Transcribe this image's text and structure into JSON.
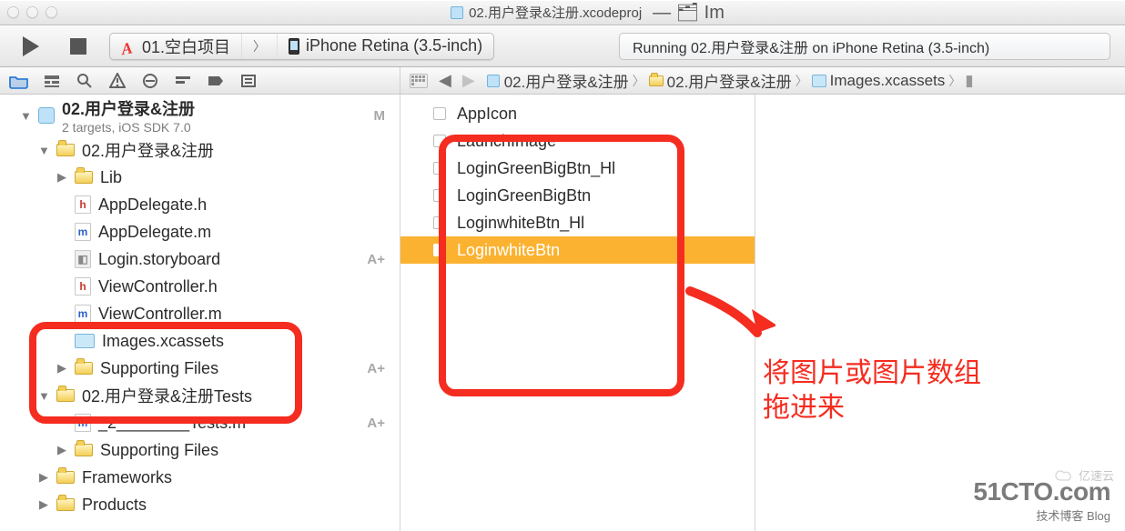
{
  "window": {
    "title": "02.用户登录&注册.xcodeproj",
    "title_suffix": "— 🗂 Im"
  },
  "toolbar": {
    "scheme_left": "01.空白项目",
    "scheme_right": "iPhone Retina (3.5-inch)",
    "status": "Running 02.用户登录&注册 on iPhone Retina (3.5-inch)"
  },
  "breadcrumbs": {
    "items": [
      "02.用户登录&注册",
      "02.用户登录&注册",
      "Images.xcassets"
    ]
  },
  "project": {
    "name": "02.用户登录&注册",
    "subtitle": "2 targets, iOS SDK 7.0",
    "badge_project": "M",
    "tree": {
      "app_group": "02.用户登录&注册",
      "lib": "Lib",
      "app_delegate_h": "AppDelegate.h",
      "app_delegate_m": "AppDelegate.m",
      "login_sb": "Login.storyboard",
      "login_sb_badge": "A+",
      "view_ctrl_h": "ViewController.h",
      "view_ctrl_m": "ViewController.m",
      "images_xcassets": "Images.xcassets",
      "supporting_files": "Supporting Files",
      "supporting_badge": "A+",
      "tests_group": "02.用户登录&注册Tests",
      "tests_m": "_2________Tests.m",
      "tests_m_badge": "A+",
      "tests_supporting": "Supporting Files",
      "frameworks": "Frameworks",
      "products": "Products"
    }
  },
  "assets": {
    "items": [
      {
        "name": "AppIcon"
      },
      {
        "name": "LaunchImage"
      },
      {
        "name": "LoginGreenBigBtn_Hl"
      },
      {
        "name": "LoginGreenBigBtn"
      },
      {
        "name": "LoginwhiteBtn_Hl"
      },
      {
        "name": "LoginwhiteBtn",
        "selected": true
      }
    ]
  },
  "annotations": {
    "hint_line1": "将图片或图片数组",
    "hint_line2": "拖进来"
  },
  "watermark": {
    "line1": "51CTO.com",
    "line2": "技术博客  Blog",
    "cloud": "亿速云"
  }
}
